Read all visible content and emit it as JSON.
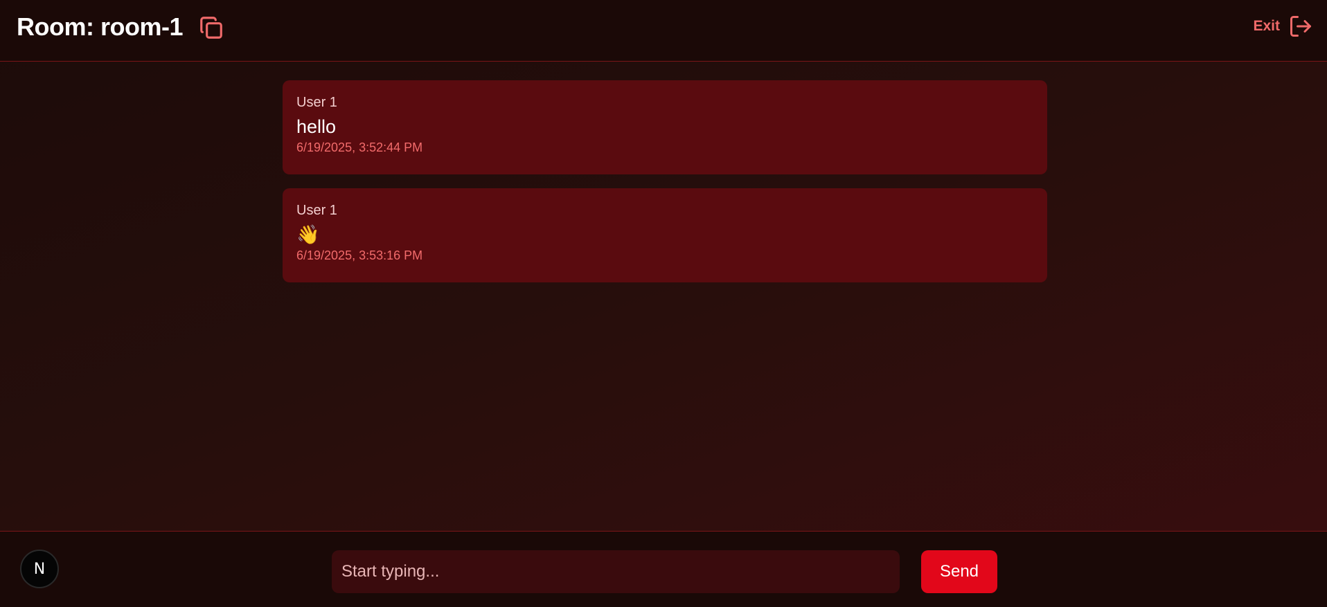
{
  "header": {
    "room_title": "Room: room-1",
    "exit_label": "Exit"
  },
  "messages": [
    {
      "user": "User 1",
      "text": "hello",
      "time": "6/19/2025, 3:52:44 PM"
    },
    {
      "user": "User 1",
      "text": "👋",
      "time": "6/19/2025, 3:53:16 PM"
    }
  ],
  "composer": {
    "placeholder": "Start typing...",
    "send_label": "Send",
    "avatar_letter": "N"
  },
  "icons": {
    "copy": "copy-icon",
    "exit": "exit-icon"
  },
  "colors": {
    "accent": "#e2071a",
    "message_bg": "#5a0b0f",
    "timestamp": "#f26b6b"
  }
}
